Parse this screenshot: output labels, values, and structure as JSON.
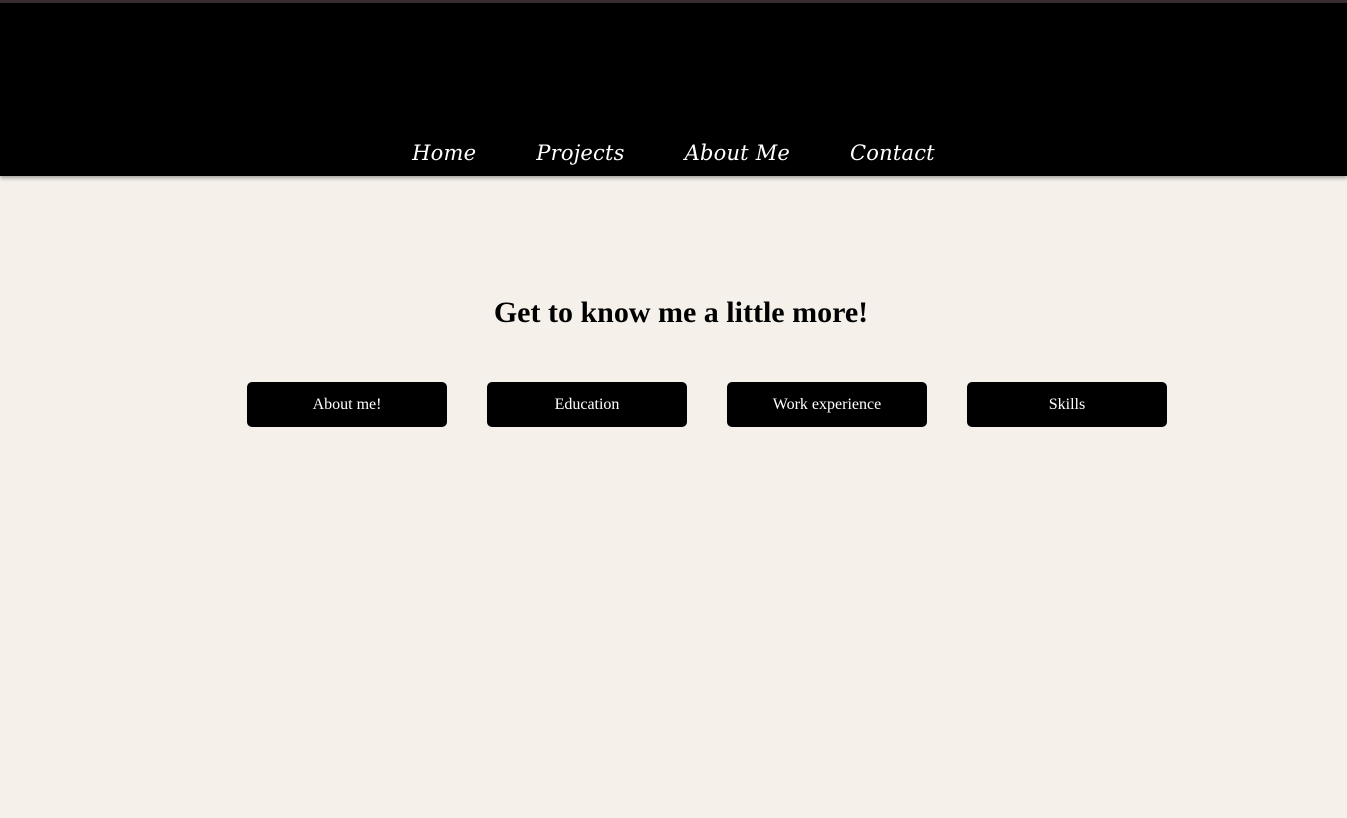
{
  "nav": {
    "items": [
      {
        "label": "Home"
      },
      {
        "label": "Projects"
      },
      {
        "label": "About Me"
      },
      {
        "label": "Contact"
      }
    ]
  },
  "main": {
    "title": "Get to know me a little more!",
    "buttons": [
      {
        "label": "About me!"
      },
      {
        "label": "Education"
      },
      {
        "label": "Work experience"
      },
      {
        "label": "Skills"
      }
    ]
  },
  "colors": {
    "header_background": "#000000",
    "page_background": "#f5f0ea",
    "button_background": "#000000",
    "button_text": "#ffffff"
  }
}
